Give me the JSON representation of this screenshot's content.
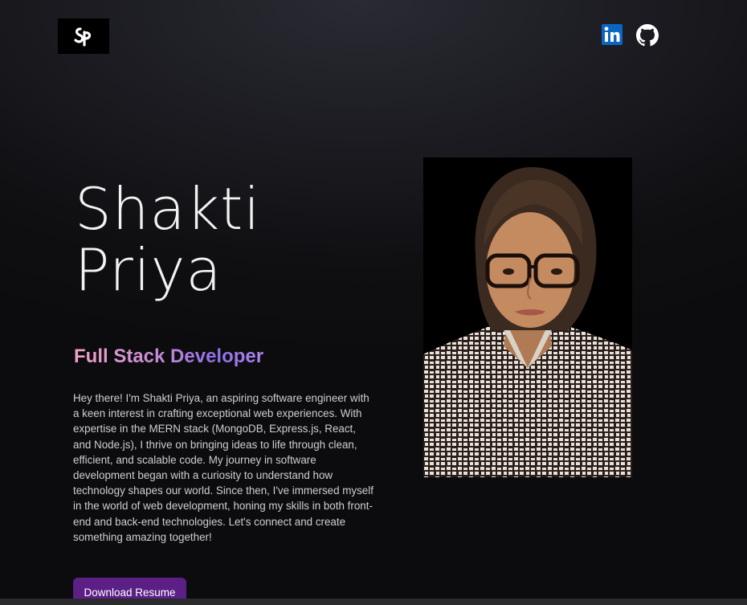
{
  "header": {
    "logo_text": "SP",
    "social": [
      {
        "icon": "linkedin-icon",
        "color": "#0a66c2"
      },
      {
        "icon": "github-icon",
        "color": "#ffffff"
      }
    ]
  },
  "hero": {
    "first_name": "Shakti",
    "last_name": "Priya",
    "role": "Full Stack Developer",
    "bio": "Hey there! I'm Shakti Priya, an aspiring software engineer with a keen interest in crafting exceptional web experiences. With expertise in the MERN stack (MongoDB, Express.js, React, and Node.js), I thrive on bringing ideas to life through clean, efficient, and scalable code. My journey in software development began with a curiosity to understand how technology shapes our world. Since then, I've immersed myself in the world of web development, honing my skills in both front-end and back-end technologies. Let's connect and create something amazing together!",
    "button_label": "Download Resume"
  },
  "colors": {
    "accent_button": "#5b1f86",
    "gradient_start": "#f1a3c7",
    "gradient_end": "#8f6ee6"
  }
}
